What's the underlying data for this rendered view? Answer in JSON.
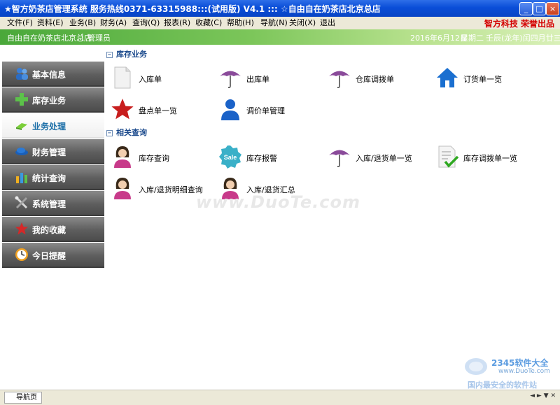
{
  "window": {
    "title": "★智方奶茶店管理系统 服务热线0371-63315988:::(试用版) V4.1 ::: ☆自由自在奶茶店北京总店",
    "buttons": {
      "minimize": "_",
      "maximize": "□",
      "close": "×"
    }
  },
  "menu": {
    "items": [
      "文件(F)",
      "资料(E)",
      "业务(B)",
      "财务(A)",
      "查询(Q)",
      "报表(R)",
      "收藏(C)",
      "帮助(H)",
      "导航(N)",
      "关闭(X)",
      "退出"
    ],
    "brand": "智方科技 荣誉出品"
  },
  "banner": {
    "store": "自由自在奶茶店北京总店",
    "separator": "|",
    "role": "管理员",
    "date": "2016年6月12日",
    "weekday": "星期二",
    "lunar": "壬辰(龙年)闰四月廿三"
  },
  "sidebar": {
    "items": [
      {
        "label": "基本信息",
        "icon": "users-icon"
      },
      {
        "label": "库存业务",
        "icon": "plus-icon"
      },
      {
        "label": "业务处理",
        "icon": "eraser-icon"
      },
      {
        "label": "财务管理",
        "icon": "cap-icon"
      },
      {
        "label": "统计查询",
        "icon": "bar-chart-icon"
      },
      {
        "label": "系统管理",
        "icon": "tools-icon"
      },
      {
        "label": "我的收藏",
        "icon": "star-icon"
      },
      {
        "label": "今日提醒",
        "icon": "clock-icon"
      }
    ],
    "active_index": 2
  },
  "sections": [
    {
      "title": "库存业务",
      "collapse": "⊟",
      "items": [
        {
          "label": "入库单",
          "icon": "document-icon"
        },
        {
          "label": "出库单",
          "icon": "umbrella-icon"
        },
        {
          "label": "仓库调拨单",
          "icon": "umbrella-icon"
        },
        {
          "label": "订货单一览",
          "icon": "home-icon"
        },
        {
          "label": "盘点单一览",
          "icon": "star-icon"
        },
        {
          "label": "调价单管理",
          "icon": "user-icon"
        }
      ]
    },
    {
      "title": "相关查询",
      "collapse": "⊟",
      "items": [
        {
          "label": "库存查询",
          "icon": "woman-icon"
        },
        {
          "label": "库存报警",
          "icon": "sale-badge-icon"
        },
        {
          "label": "入库/退货单一览",
          "icon": "umbrella-icon"
        },
        {
          "label": "库存调拨单一览",
          "icon": "checklist-icon"
        },
        {
          "label": "入库/退货明细查询",
          "icon": "woman-icon"
        },
        {
          "label": "入库/退货汇总",
          "icon": "woman-icon"
        }
      ]
    }
  ],
  "sale_badge_text": "Sale",
  "watermarks": {
    "main": "www.DuoTe.com",
    "corner_title": "2345软件大全",
    "corner_url": "www.DuoTe.com",
    "corner_slogan": "国内最安全的软件站"
  },
  "statusbar": {
    "tab": "导航页",
    "arrows": "◄ ► ▼ ✕"
  },
  "colors": {
    "titlebar": "#0a4ed8",
    "active_nav_text": "#1c6fa8",
    "section_title": "#1b4a8c",
    "brand": "#d40000"
  }
}
